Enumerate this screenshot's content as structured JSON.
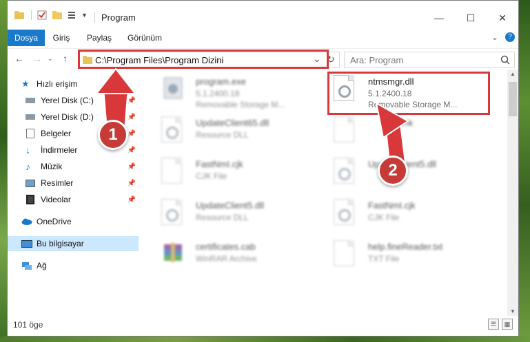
{
  "window": {
    "title": "Program",
    "minimize": "—",
    "maximize": "☐",
    "close": "✕"
  },
  "ribbon": {
    "tabs": [
      "Dosya",
      "Giriş",
      "Paylaş",
      "Görünüm"
    ],
    "expand_icon": "chevron-down",
    "help_icon": "?"
  },
  "address_bar": {
    "path": "C:\\Program Files\\Program Dizini",
    "dropdown": "⌄",
    "refresh": "↻"
  },
  "search": {
    "placeholder": "Ara: Program",
    "icon": "search-icon"
  },
  "sidebar": {
    "items": [
      {
        "label": "Hızlı erişim",
        "icon": "star-icon",
        "pinned": false
      },
      {
        "label": "Yerel Disk (C:)",
        "icon": "drive-icon",
        "pinned": true
      },
      {
        "label": "Yerel Disk (D:)",
        "icon": "drive-icon",
        "pinned": true
      },
      {
        "label": "Belgeler",
        "icon": "documents-icon",
        "pinned": true
      },
      {
        "label": "İndirmeler",
        "icon": "download-icon",
        "pinned": true
      },
      {
        "label": "Müzik",
        "icon": "music-icon",
        "pinned": true
      },
      {
        "label": "Resimler",
        "icon": "pictures-icon",
        "pinned": true
      },
      {
        "label": "Videolar",
        "icon": "video-icon",
        "pinned": true
      },
      {
        "label": "OneDrive",
        "icon": "cloud-icon",
        "pinned": false
      },
      {
        "label": "Bu bilgisayar",
        "icon": "computer-icon",
        "pinned": false,
        "selected": true
      },
      {
        "label": "Ağ",
        "icon": "network-icon",
        "pinned": false
      }
    ]
  },
  "files": [
    {
      "name": "program.exe",
      "line1": "5.1.2400.18",
      "line2": "Removable Storage M...",
      "icon": "exe-icon",
      "blurred": true
    },
    {
      "name": "ntmsmgr.dll",
      "line1": "5.1.2400.18",
      "line2": "Removable Storage M...",
      "icon": "dll-gear-icon",
      "blurred": false
    },
    {
      "name": "UpdateClient65.dll",
      "line1": "Resource DLL",
      "line2": "",
      "icon": "dll-gear-icon",
      "blurred": true
    },
    {
      "name": "ik.chk",
      "line1": "",
      "line2": "",
      "icon": "blank-file-icon",
      "blurred": true
    },
    {
      "name": "FastNmI.cjk",
      "line1": "CJK File",
      "line2": "",
      "icon": "blank-file-icon",
      "blurred": true
    },
    {
      "name": "UpdateClient5.dll",
      "line1": "",
      "line2": "",
      "icon": "dll-gear-icon",
      "blurred": true
    },
    {
      "name": "UpdateClient5.dll",
      "line1": "Resource DLL",
      "line2": "",
      "icon": "dll-gear-icon",
      "blurred": true
    },
    {
      "name": "FastNmI.cjk",
      "line1": "CJK File",
      "line2": "",
      "icon": "blank-file-icon",
      "blurred": true
    },
    {
      "name": "certificates.cab",
      "line1": "WinRAR Archive",
      "line2": "",
      "icon": "winrar-icon",
      "blurred": true
    },
    {
      "name": "help.fineReader.txt",
      "line1": "TXT File",
      "line2": "",
      "icon": "text-file-icon",
      "blurred": true
    }
  ],
  "status": {
    "count": "101 öge"
  },
  "annotations": {
    "badge1": "1",
    "badge2": "2",
    "color": "#d9383a"
  }
}
